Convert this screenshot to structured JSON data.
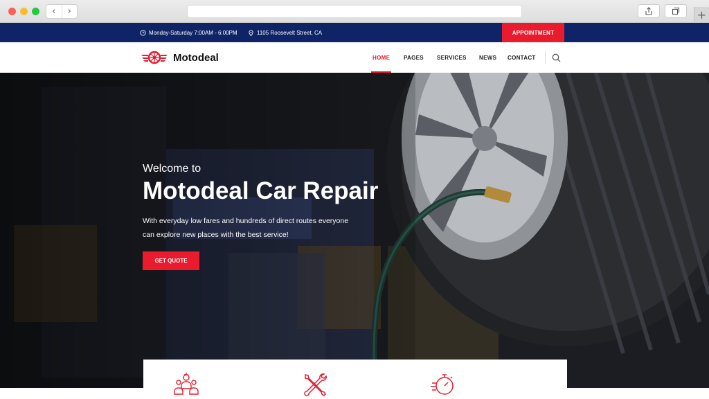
{
  "browser": {
    "back_glyph": "‹",
    "forward_glyph": "›",
    "new_tab_glyph": "+"
  },
  "topbar": {
    "hours": "Monday-Saturday 7:00AM - 6:00PM",
    "address": "1105 Roosevelt Street, CA",
    "appointment_label": "APPOINTMENT"
  },
  "header": {
    "logo_text": "Motodeal",
    "nav": [
      {
        "label": "HOME",
        "active": true
      },
      {
        "label": "PAGES"
      },
      {
        "label": "SERVICES"
      },
      {
        "label": "NEWS"
      },
      {
        "label": "CONTACT"
      }
    ]
  },
  "hero": {
    "welcome": "Welcome to",
    "title": "Motodeal Car Repair",
    "desc_line1": "With everyday low fares and hundreds of direct routes everyone",
    "desc_line2": "can explore new places with the best service!",
    "cta_label": "GET QUOTE"
  },
  "services": {
    "icons": [
      "mechanics-team-icon",
      "wrench-screwdriver-icon",
      "stopwatch-icon"
    ]
  },
  "colors": {
    "accent": "#ea1b2d",
    "topbar": "#0f2466"
  }
}
